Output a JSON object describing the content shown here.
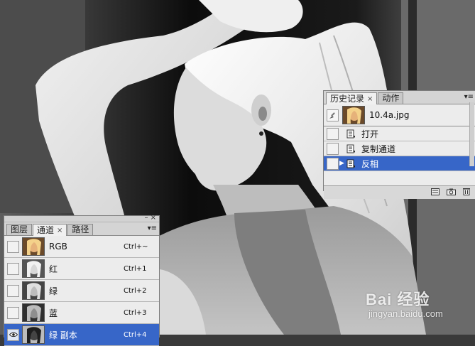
{
  "channels_panel": {
    "tabs": [
      {
        "label": "图层",
        "active": false
      },
      {
        "label": "通道",
        "active": true
      },
      {
        "label": "路径",
        "active": false
      }
    ],
    "close_glyph": "×",
    "menu_glyph": "▾≡",
    "items": [
      {
        "name": "RGB",
        "shortcut": "Ctrl+~",
        "visible": false,
        "selected": false
      },
      {
        "name": "红",
        "shortcut": "Ctrl+1",
        "visible": false,
        "selected": false
      },
      {
        "name": "绿",
        "shortcut": "Ctrl+2",
        "visible": false,
        "selected": false
      },
      {
        "name": "蓝",
        "shortcut": "Ctrl+3",
        "visible": false,
        "selected": false
      },
      {
        "name": "绿 副本",
        "shortcut": "Ctrl+4",
        "visible": true,
        "selected": true
      }
    ]
  },
  "history_panel": {
    "tabs": [
      {
        "label": "历史记录",
        "active": true
      },
      {
        "label": "动作",
        "active": false
      }
    ],
    "close_glyph": "×",
    "menu_glyph": "▾≡",
    "snapshot": {
      "label": "10.4a.jpg"
    },
    "steps": [
      {
        "label": "打开",
        "selected": false
      },
      {
        "label": "复制通道",
        "selected": false
      },
      {
        "label": "反相",
        "selected": true
      }
    ],
    "footer_icons": [
      "new-document-icon",
      "camera-icon",
      "trash-icon"
    ]
  },
  "watermark": {
    "main": "Bai 经验",
    "sub": "jingyan.baidu.com"
  },
  "colors": {
    "selection": "#3766c8",
    "panel_bg": "#e4e4e4"
  }
}
